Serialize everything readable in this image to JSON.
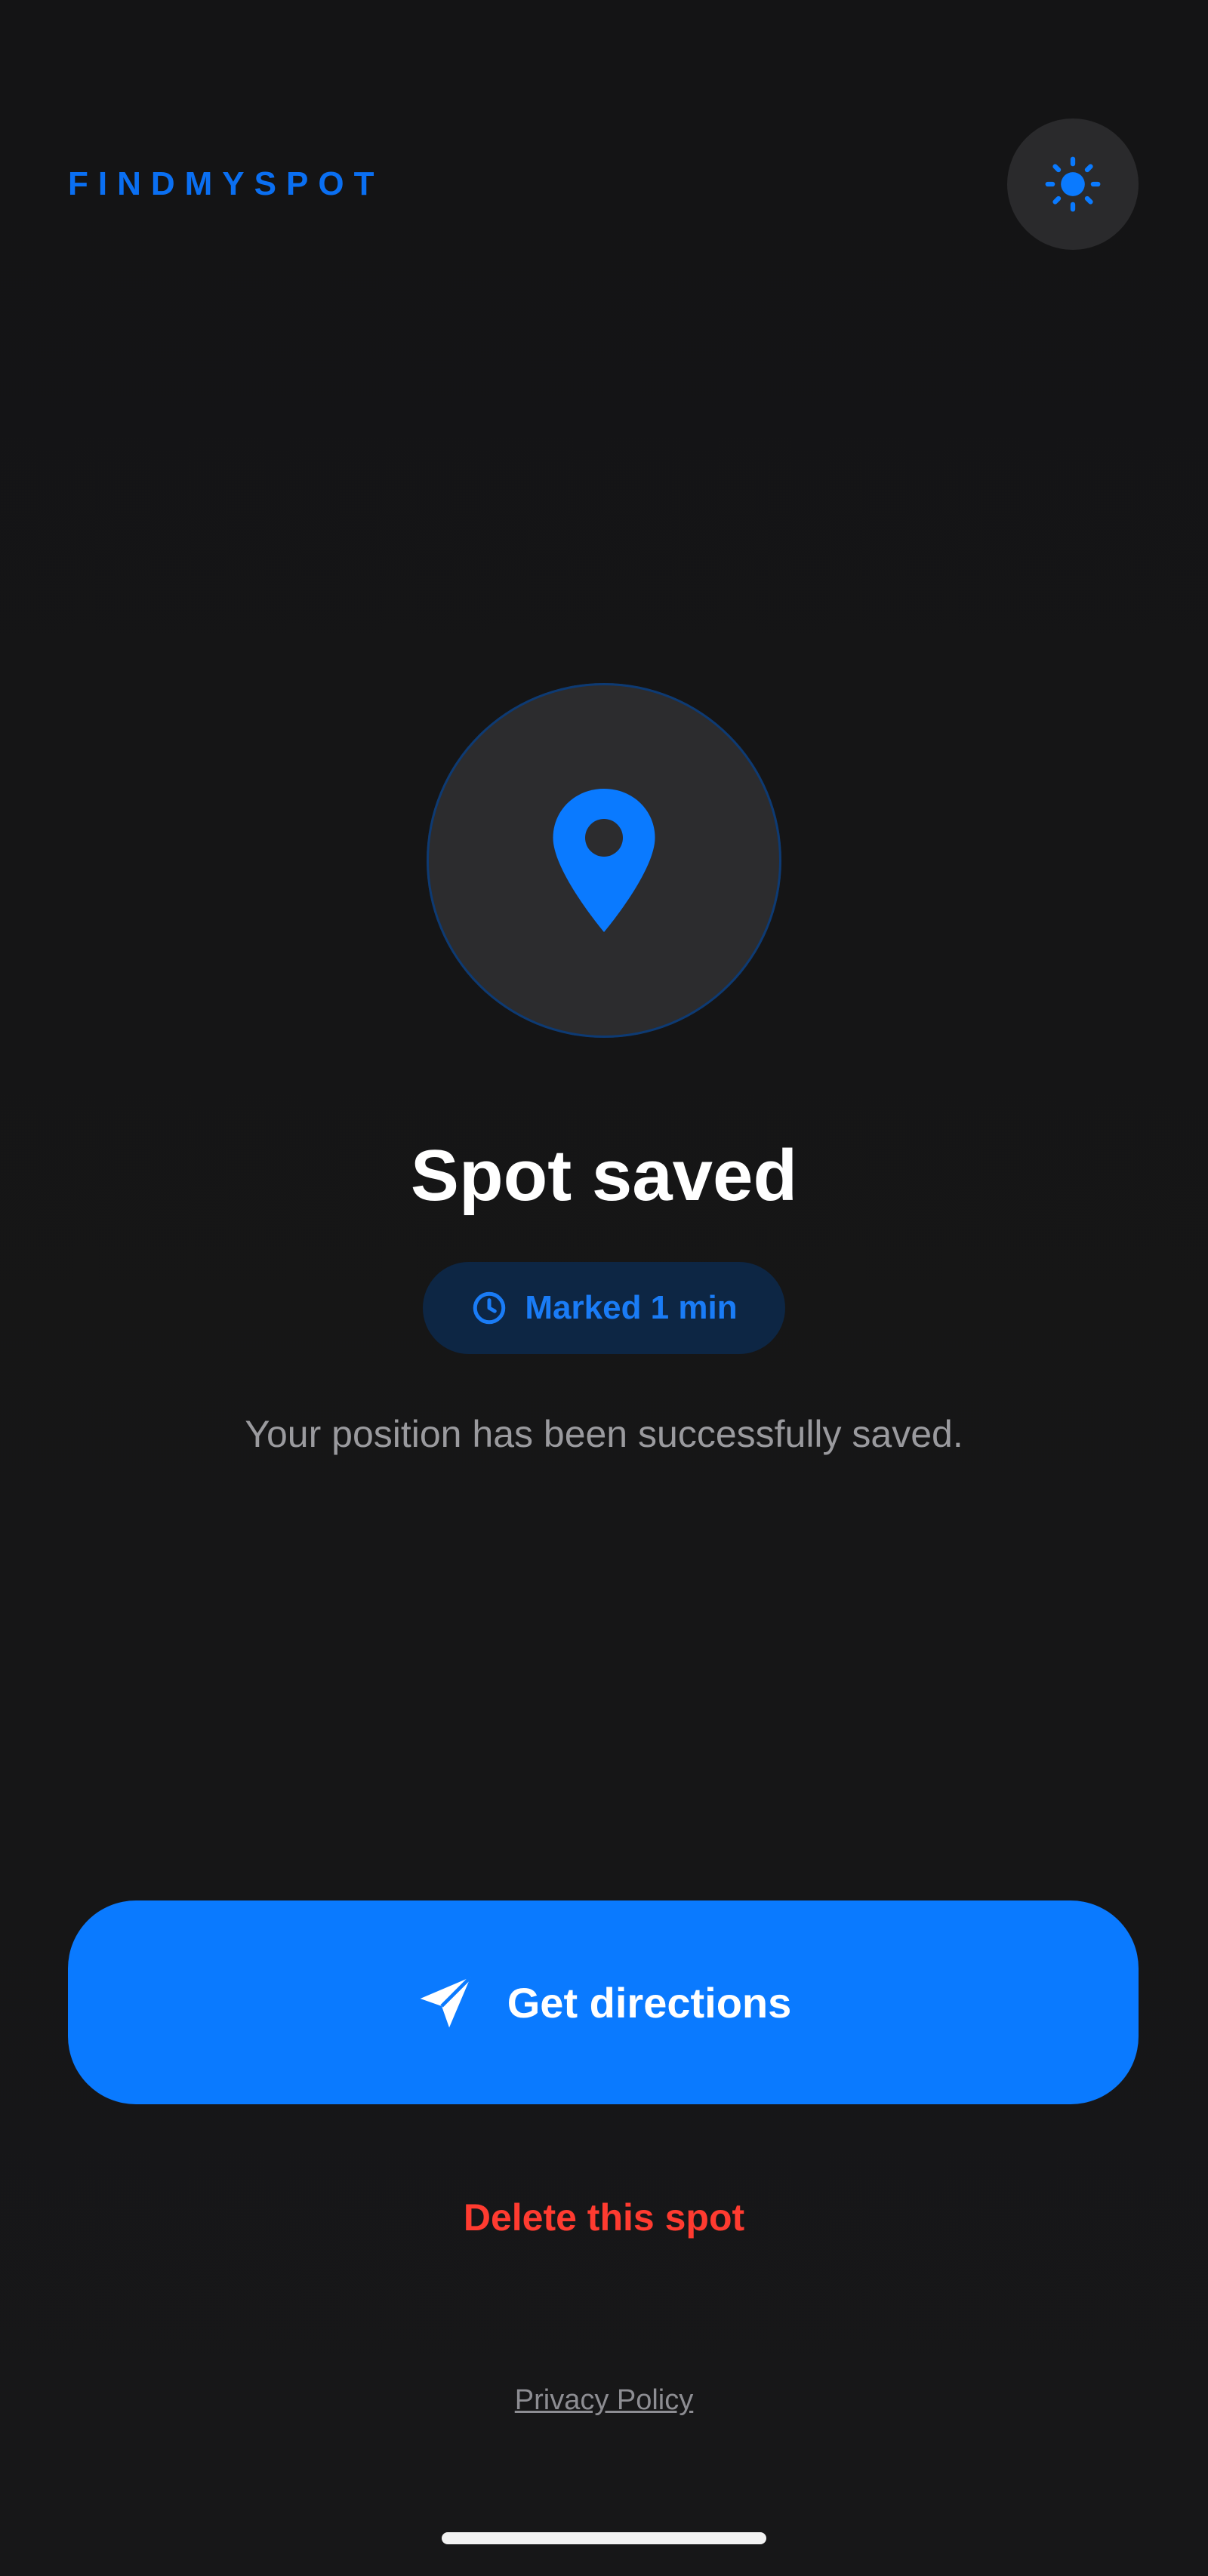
{
  "app": {
    "brand": "FINDMYSPOT",
    "accent_color": "#0a7aff",
    "danger_color": "#ff3b30",
    "background_color": "#141415"
  },
  "header": {
    "theme_toggle_icon": "sun-icon"
  },
  "hero": {
    "icon": "location-pin-icon",
    "title": "Spot saved",
    "badge": {
      "icon": "clock-icon",
      "label": "Marked 1 min"
    },
    "subtitle": "Your position has been successfully saved."
  },
  "actions": {
    "primary": {
      "icon": "navigation-arrow-icon",
      "label": "Get directions"
    },
    "delete_label": "Delete this spot",
    "privacy_label": "Privacy Policy"
  }
}
